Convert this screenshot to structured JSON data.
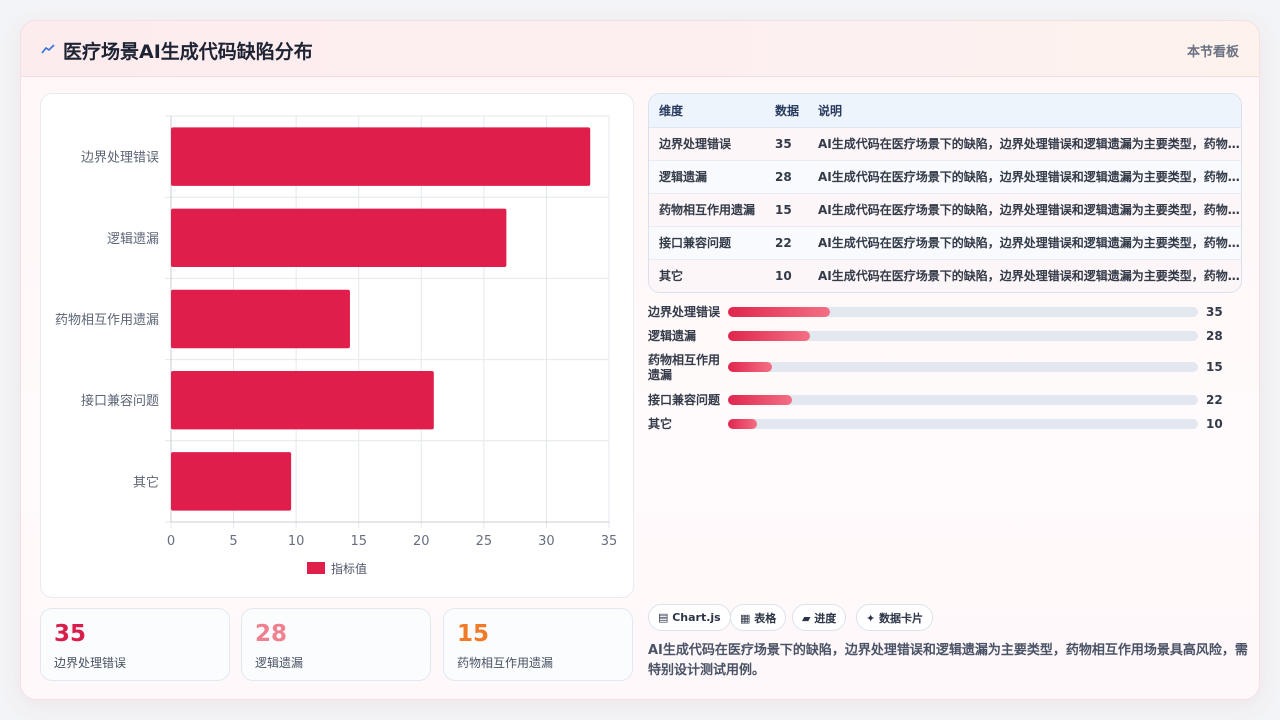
{
  "header": {
    "title": "医疗场景AI生成代码缺陷分布",
    "title_icon": "trend-line-icon",
    "right_label": "本节看板"
  },
  "chart_data": {
    "type": "bar",
    "orientation": "horizontal",
    "categories": [
      "边界处理错误",
      "逻辑遗漏",
      "药物相互作用遗漏",
      "接口兼容问题",
      "其它"
    ],
    "series": [
      {
        "name": "指标值",
        "values": [
          33.5,
          26.8,
          14.3,
          21,
          9.6
        ],
        "color": "#e01e4b"
      }
    ],
    "xlim": [
      0,
      35
    ],
    "xticks": [
      0,
      5,
      10,
      15,
      20,
      25,
      30,
      35
    ],
    "grid": true,
    "legend": "bottom"
  },
  "stats": [
    {
      "value": "35",
      "label": "边界处理错误",
      "color": "#d81e4a"
    },
    {
      "value": "28",
      "label": "逻辑遗漏",
      "color": "#f08090"
    },
    {
      "value": "15",
      "label": "药物相互作用遗漏",
      "color": "#f07a28"
    }
  ],
  "table": {
    "headers": [
      "维度",
      "数据",
      "说明"
    ],
    "rows": [
      [
        "边界处理错误",
        "35",
        "AI生成代码在医疗场景下的缺陷，边界处理错误和逻辑遗漏为主要类型，药物相互作用场景具高风险，需特别设计测试用例。"
      ],
      [
        "逻辑遗漏",
        "28",
        "AI生成代码在医疗场景下的缺陷，边界处理错误和逻辑遗漏为主要类型，药物相互作用场景具高风险，需特别设计测试用例。"
      ],
      [
        "药物相互作用遗漏",
        "15",
        "AI生成代码在医疗场景下的缺陷，边界处理错误和逻辑遗漏为主要类型，药物相互作用场景具高风险，需特别设计测试用例。"
      ],
      [
        "接口兼容问题",
        "22",
        "AI生成代码在医疗场景下的缺陷，边界处理错误和逻辑遗漏为主要类型，药物相互作用场景具高风险，需特别设计测试用例。"
      ],
      [
        "其它",
        "10",
        "AI生成代码在医疗场景下的缺陷，边界处理错误和逻辑遗漏为主要类型，药物相互作用场景具高风险，需特别设计测试用例。"
      ]
    ]
  },
  "progress": [
    {
      "label": "边界处理错误",
      "value": "35",
      "fraction": 0.217
    },
    {
      "label": "逻辑遗漏",
      "value": "28",
      "fraction": 0.174
    },
    {
      "label": "药物相互作用遗漏",
      "value": "15",
      "fraction": 0.093
    },
    {
      "label": "接口兼容问题",
      "value": "22",
      "fraction": 0.137
    },
    {
      "label": "其它",
      "value": "10",
      "fraction": 0.062
    }
  ],
  "tags": [
    {
      "icon": "chart-icon",
      "label": "▤ Chart.js"
    },
    {
      "icon": "table-icon",
      "label": "▦ 表格"
    },
    {
      "icon": "progress-icon",
      "label": "▰ 进度"
    },
    {
      "icon": "card-icon",
      "label": "✦ 数据卡片"
    }
  ],
  "description": "AI生成代码在医疗场景下的缺陷，边界处理错误和逻辑遗漏为主要类型，药物相互作用场景具高风险，需特别设计测试用例。"
}
